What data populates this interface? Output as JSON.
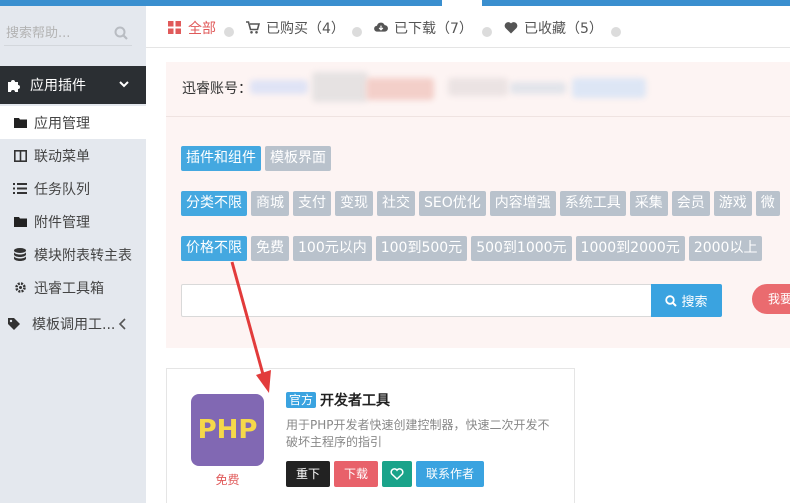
{
  "sidebar": {
    "search_placeholder": "搜索帮助...",
    "section_title": "应用插件",
    "items": [
      {
        "label": "应用管理",
        "icon": "folder-icon"
      },
      {
        "label": "联动菜单",
        "icon": "columns-icon"
      },
      {
        "label": "任务队列",
        "icon": "list-icon"
      },
      {
        "label": "附件管理",
        "icon": "folder-icon"
      },
      {
        "label": "模块附表转主表",
        "icon": "database-icon"
      },
      {
        "label": "迅睿工具箱",
        "icon": "gear-icon"
      },
      {
        "label": "模板调用工...",
        "icon": "tag-icon"
      }
    ]
  },
  "tabs": [
    {
      "label": "全部",
      "icon": "grid-icon"
    },
    {
      "label": "已购买（4）",
      "icon": "cart-icon"
    },
    {
      "label": "已下载（7）",
      "icon": "cloud-download-icon"
    },
    {
      "label": "已收藏（5）",
      "icon": "heart-icon"
    }
  ],
  "account": {
    "label": "迅睿账号："
  },
  "filters": {
    "type_row": [
      "插件和组件",
      "模板界面"
    ],
    "category_row": [
      "分类不限",
      "商城",
      "支付",
      "变现",
      "社交",
      "SEO优化",
      "内容增强",
      "系统工具",
      "采集",
      "会员",
      "游戏",
      "微"
    ],
    "price_row": [
      "价格不限",
      "免费",
      "100元以内",
      "100到500元",
      "500到1000元",
      "1000到2000元",
      "2000以上"
    ]
  },
  "search": {
    "value": "",
    "button_label": "搜索",
    "want_label": "我要"
  },
  "card": {
    "logo_text": "PHP",
    "price": "免费",
    "badge": "官方",
    "title": "开发者工具",
    "description": "用于PHP开发者快速创建控制器，快速二次开发不破坏主程序的指引",
    "actions": {
      "reinstall": "重下",
      "download": "下载",
      "contact": "联系作者"
    }
  },
  "colors": {
    "accent": "#3aa3e0",
    "danger": "#e8616a",
    "sidebar_dark": "#2b2f33"
  }
}
